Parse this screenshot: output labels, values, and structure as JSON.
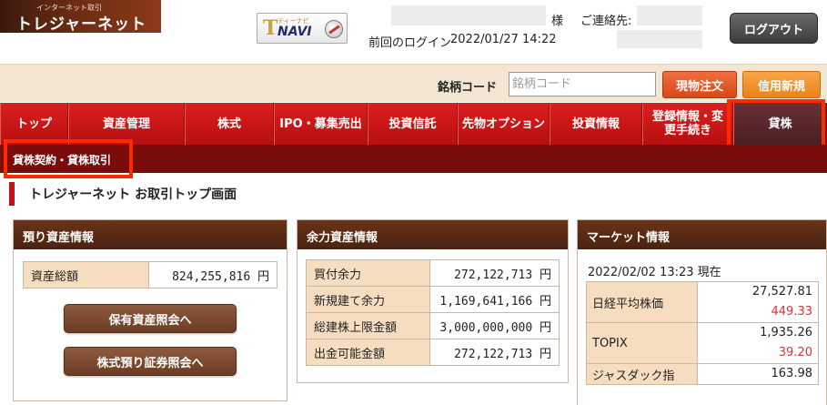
{
  "header": {
    "logo_small": "インターネット取引",
    "logo_main": "トレジャーネット",
    "tnavi_small": "ティーナビ",
    "tnavi_main": "NAVI",
    "tnavi_t": "T",
    "honorific": "様",
    "contact_label": "ご連絡先:",
    "last_login_label": "前回のログイン",
    "last_login_value": "2022/01/27 14:22",
    "logout_label": "ログアウト"
  },
  "search": {
    "label": "銘柄コード",
    "placeholder": "銘柄コード",
    "spot_order_label": "現物注文",
    "margin_new_label": "信用新規"
  },
  "nav": {
    "items": [
      {
        "label": "トップ"
      },
      {
        "label": "資産管理"
      },
      {
        "label": "株式"
      },
      {
        "label": "IPO・募集売出"
      },
      {
        "label": "投資信託"
      },
      {
        "label": "先物オプション"
      },
      {
        "label": "投資情報"
      },
      {
        "label": "登録情報・変更手続き"
      },
      {
        "label": "貸株"
      }
    ],
    "active_index": 8
  },
  "subnav": {
    "item": "貸株契約・貸株取引"
  },
  "page": {
    "title": "トレジャーネット お取引トップ画面"
  },
  "assets_panel": {
    "title": "預り資産情報",
    "rows": [
      {
        "label": "資産総額",
        "value": "824,255,816 円"
      }
    ],
    "holdings_button": "保有資産照会へ",
    "stock_deposit_button": "株式預り証券照会へ"
  },
  "margin_panel": {
    "title": "余力資産情報",
    "rows": [
      {
        "label": "買付余力",
        "value": "272,122,713 円"
      },
      {
        "label": "新規建て余力",
        "value": "1,169,641,166 円"
      },
      {
        "label": "総建株上限金額",
        "value": "3,000,000,000 円"
      },
      {
        "label": "出金可能金額",
        "value": "272,122,713 円"
      }
    ]
  },
  "market_panel": {
    "title": "マーケット情報",
    "timestamp": "2022/02/02 13:23 現在",
    "rows": [
      {
        "label": "日経平均株価",
        "value": "27,527.81",
        "change": "449.33"
      },
      {
        "label": "TOPIX",
        "value": "1,935.26",
        "change": "39.20"
      },
      {
        "label": "ジャスダック指",
        "value": "163.98",
        "change": ""
      }
    ]
  },
  "colors": {
    "nav_red": "#d41a1a",
    "nav_active": "#5a252a",
    "panel_head_brown": "#5a2b14",
    "highlight": "#ff2a00",
    "positive_change": "#d33636"
  }
}
